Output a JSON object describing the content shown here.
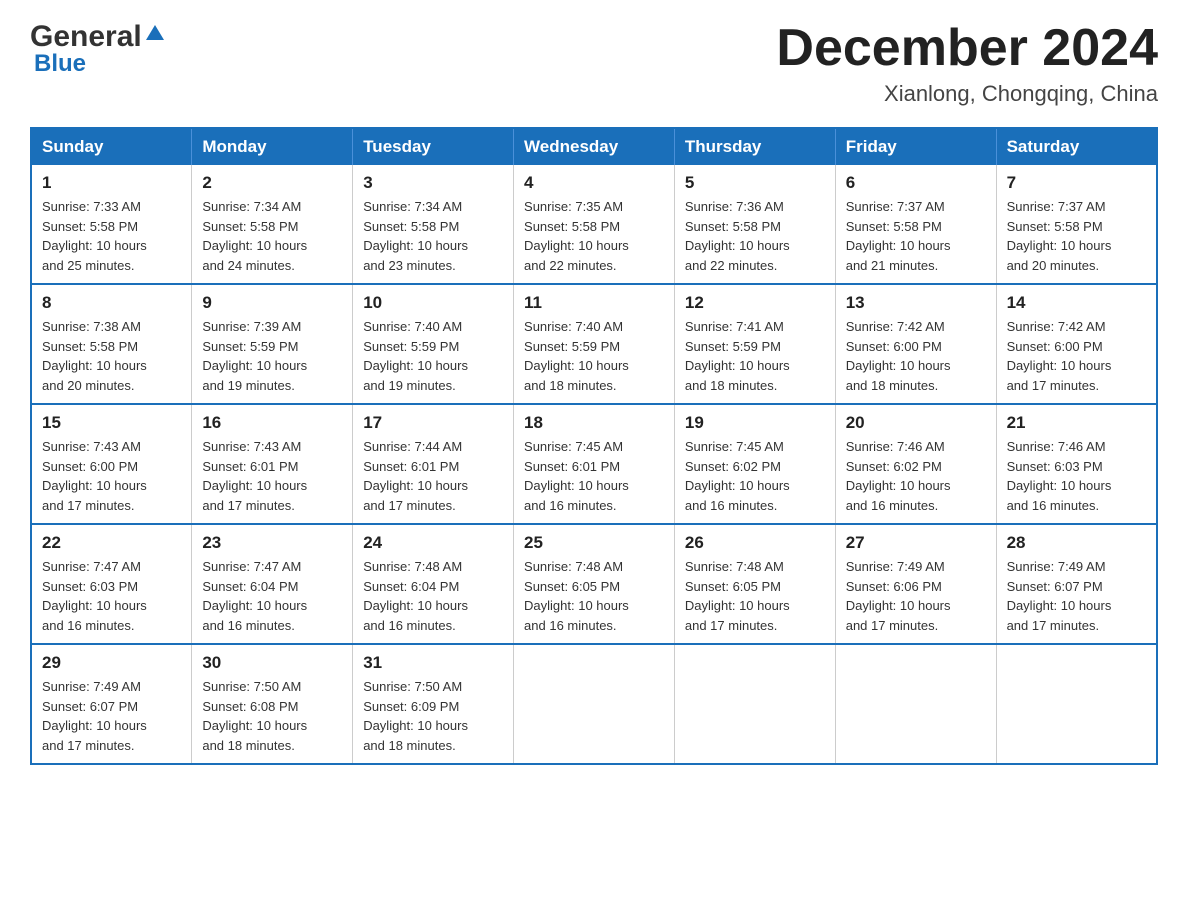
{
  "header": {
    "logo_general": "General",
    "logo_blue": "Blue",
    "month_title": "December 2024",
    "location": "Xianlong, Chongqing, China"
  },
  "days_of_week": [
    "Sunday",
    "Monday",
    "Tuesday",
    "Wednesday",
    "Thursday",
    "Friday",
    "Saturday"
  ],
  "weeks": [
    [
      {
        "day": "1",
        "sunrise": "7:33 AM",
        "sunset": "5:58 PM",
        "daylight": "10 hours and 25 minutes."
      },
      {
        "day": "2",
        "sunrise": "7:34 AM",
        "sunset": "5:58 PM",
        "daylight": "10 hours and 24 minutes."
      },
      {
        "day": "3",
        "sunrise": "7:34 AM",
        "sunset": "5:58 PM",
        "daylight": "10 hours and 23 minutes."
      },
      {
        "day": "4",
        "sunrise": "7:35 AM",
        "sunset": "5:58 PM",
        "daylight": "10 hours and 22 minutes."
      },
      {
        "day": "5",
        "sunrise": "7:36 AM",
        "sunset": "5:58 PM",
        "daylight": "10 hours and 22 minutes."
      },
      {
        "day": "6",
        "sunrise": "7:37 AM",
        "sunset": "5:58 PM",
        "daylight": "10 hours and 21 minutes."
      },
      {
        "day": "7",
        "sunrise": "7:37 AM",
        "sunset": "5:58 PM",
        "daylight": "10 hours and 20 minutes."
      }
    ],
    [
      {
        "day": "8",
        "sunrise": "7:38 AM",
        "sunset": "5:58 PM",
        "daylight": "10 hours and 20 minutes."
      },
      {
        "day": "9",
        "sunrise": "7:39 AM",
        "sunset": "5:59 PM",
        "daylight": "10 hours and 19 minutes."
      },
      {
        "day": "10",
        "sunrise": "7:40 AM",
        "sunset": "5:59 PM",
        "daylight": "10 hours and 19 minutes."
      },
      {
        "day": "11",
        "sunrise": "7:40 AM",
        "sunset": "5:59 PM",
        "daylight": "10 hours and 18 minutes."
      },
      {
        "day": "12",
        "sunrise": "7:41 AM",
        "sunset": "5:59 PM",
        "daylight": "10 hours and 18 minutes."
      },
      {
        "day": "13",
        "sunrise": "7:42 AM",
        "sunset": "6:00 PM",
        "daylight": "10 hours and 18 minutes."
      },
      {
        "day": "14",
        "sunrise": "7:42 AM",
        "sunset": "6:00 PM",
        "daylight": "10 hours and 17 minutes."
      }
    ],
    [
      {
        "day": "15",
        "sunrise": "7:43 AM",
        "sunset": "6:00 PM",
        "daylight": "10 hours and 17 minutes."
      },
      {
        "day": "16",
        "sunrise": "7:43 AM",
        "sunset": "6:01 PM",
        "daylight": "10 hours and 17 minutes."
      },
      {
        "day": "17",
        "sunrise": "7:44 AM",
        "sunset": "6:01 PM",
        "daylight": "10 hours and 17 minutes."
      },
      {
        "day": "18",
        "sunrise": "7:45 AM",
        "sunset": "6:01 PM",
        "daylight": "10 hours and 16 minutes."
      },
      {
        "day": "19",
        "sunrise": "7:45 AM",
        "sunset": "6:02 PM",
        "daylight": "10 hours and 16 minutes."
      },
      {
        "day": "20",
        "sunrise": "7:46 AM",
        "sunset": "6:02 PM",
        "daylight": "10 hours and 16 minutes."
      },
      {
        "day": "21",
        "sunrise": "7:46 AM",
        "sunset": "6:03 PM",
        "daylight": "10 hours and 16 minutes."
      }
    ],
    [
      {
        "day": "22",
        "sunrise": "7:47 AM",
        "sunset": "6:03 PM",
        "daylight": "10 hours and 16 minutes."
      },
      {
        "day": "23",
        "sunrise": "7:47 AM",
        "sunset": "6:04 PM",
        "daylight": "10 hours and 16 minutes."
      },
      {
        "day": "24",
        "sunrise": "7:48 AM",
        "sunset": "6:04 PM",
        "daylight": "10 hours and 16 minutes."
      },
      {
        "day": "25",
        "sunrise": "7:48 AM",
        "sunset": "6:05 PM",
        "daylight": "10 hours and 16 minutes."
      },
      {
        "day": "26",
        "sunrise": "7:48 AM",
        "sunset": "6:05 PM",
        "daylight": "10 hours and 17 minutes."
      },
      {
        "day": "27",
        "sunrise": "7:49 AM",
        "sunset": "6:06 PM",
        "daylight": "10 hours and 17 minutes."
      },
      {
        "day": "28",
        "sunrise": "7:49 AM",
        "sunset": "6:07 PM",
        "daylight": "10 hours and 17 minutes."
      }
    ],
    [
      {
        "day": "29",
        "sunrise": "7:49 AM",
        "sunset": "6:07 PM",
        "daylight": "10 hours and 17 minutes."
      },
      {
        "day": "30",
        "sunrise": "7:50 AM",
        "sunset": "6:08 PM",
        "daylight": "10 hours and 18 minutes."
      },
      {
        "day": "31",
        "sunrise": "7:50 AM",
        "sunset": "6:09 PM",
        "daylight": "10 hours and 18 minutes."
      },
      null,
      null,
      null,
      null
    ]
  ],
  "labels": {
    "sunrise": "Sunrise:",
    "sunset": "Sunset:",
    "daylight": "Daylight:"
  }
}
